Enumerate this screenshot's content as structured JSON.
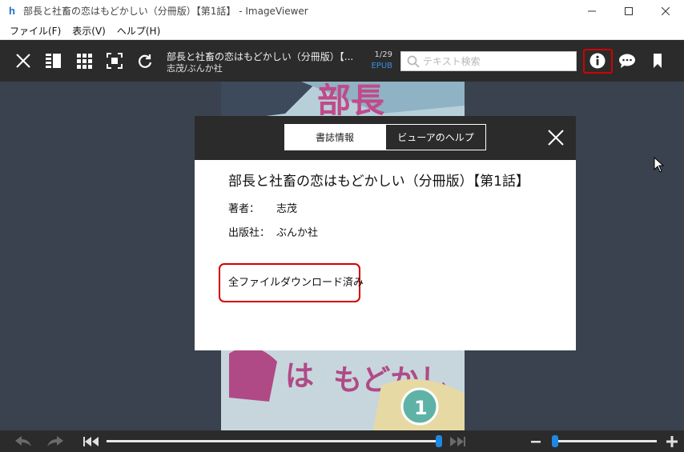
{
  "window": {
    "title": "部長と社畜の恋はもどかしい（分冊版）【第1話】 - ImageViewer",
    "app_icon": "h",
    "controls": [
      "minimize-icon",
      "maximize-icon",
      "close-icon"
    ]
  },
  "menu": {
    "items": [
      "ファイル(F)",
      "表示(V)",
      "ヘルプ(H)"
    ]
  },
  "toolbar": {
    "book_title": "部長と社畜の恋はもどかしい（分冊版）【...",
    "author": "志茂/ぶんか社",
    "page": "1/29",
    "format": "EPUB",
    "search_placeholder": "テキスト検索",
    "search_value": "",
    "icons": [
      "close-icon",
      "toc-icon",
      "grid-icon",
      "fit-screen-icon",
      "rotate-icon",
      "search-icon",
      "info-icon",
      "comment-icon",
      "bookmark-icon"
    ]
  },
  "modal": {
    "tabs": [
      {
        "label": "書誌情報",
        "active": true
      },
      {
        "label": "ビューアのヘルプ",
        "active": false
      }
    ],
    "title": "部長と社畜の恋はもどかしい（分冊版）【第1話】",
    "author_label": "著者：",
    "author_value": "志茂",
    "publisher_label": "出版社：",
    "publisher_value": "ぶんか社",
    "download_status": "全ファイルダウンロード済み"
  },
  "bottombar": {
    "icons": [
      "undo-icon",
      "redo-icon",
      "skip-to-start-icon",
      "skip-to-end-icon",
      "zoom-out-icon",
      "zoom-in-icon"
    ],
    "page_slider_fraction": 1.0,
    "zoom_slider_fraction": 0.0
  },
  "colors": {
    "toolbar_bg": "#2b2b2b",
    "viewer_bg": "#3a4250",
    "accent": "#1e88e5",
    "highlight": "#d40000"
  }
}
